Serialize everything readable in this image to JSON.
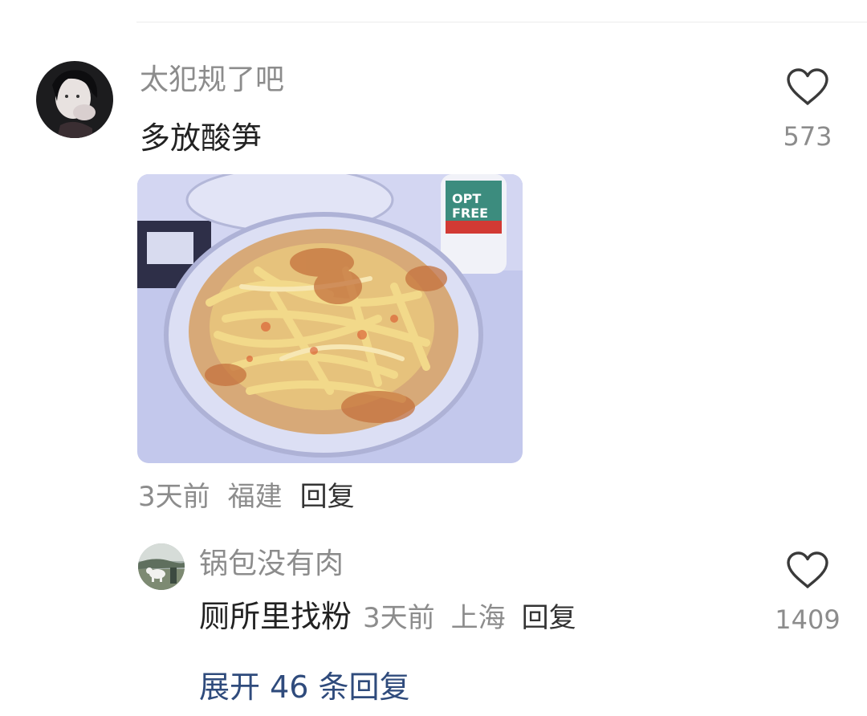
{
  "comment": {
    "username": "太犯规了吧",
    "text": "多放酸笋",
    "time": "3天前",
    "location": "福建",
    "reply_label": "回复",
    "likes": "573",
    "avatar_icon": "user-avatar",
    "photo_icon": "food-photo"
  },
  "reply": {
    "username": "锅包没有肉",
    "text": "厕所里找粉",
    "time": "3天前",
    "location": "上海",
    "reply_label": "回复",
    "likes": "1409",
    "avatar_icon": "user-avatar"
  },
  "expand_label": "展开 46 条回复",
  "colors": {
    "username": "#8c8c8c",
    "text": "#222222",
    "meta": "#8c8c8c",
    "link": "#2f4b7c"
  }
}
